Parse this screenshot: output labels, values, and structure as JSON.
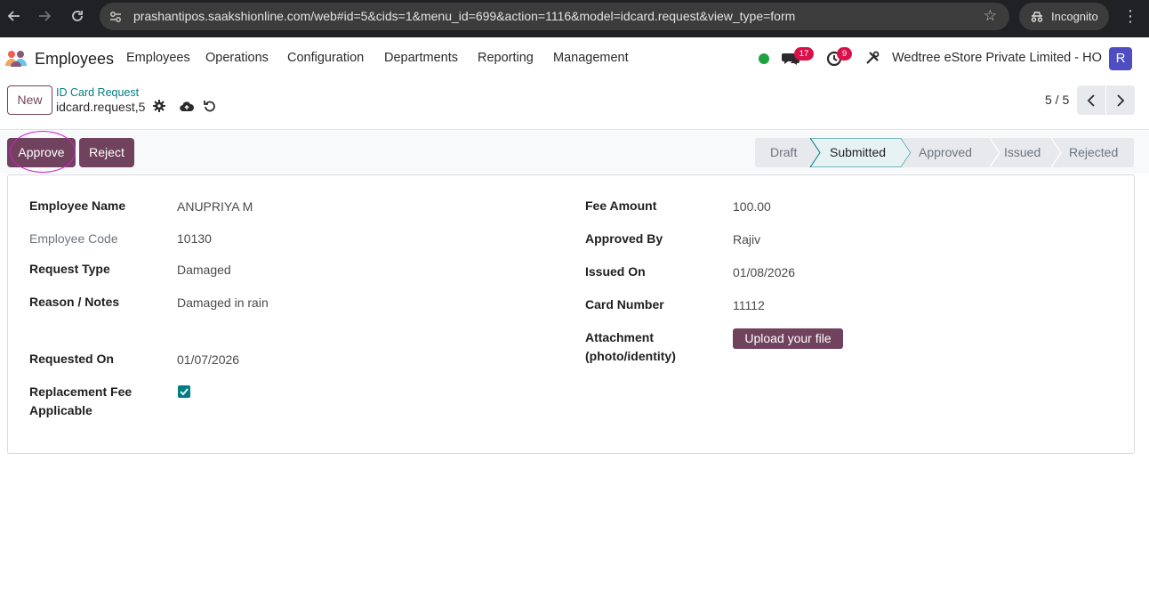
{
  "browser": {
    "url": "prashantipos.saakshionline.com/web#id=5&cids=1&menu_id=699&action=1116&model=idcard.request&view_type=form",
    "incognito_label": "Incognito"
  },
  "navbar": {
    "app_name": "Employees",
    "menu": [
      "Employees",
      "Operations",
      "Configuration",
      "Departments",
      "Reporting",
      "Management"
    ],
    "messages_count": "17",
    "activities_count": "9",
    "company": "Wedtree eStore Private Limited - HO",
    "avatar_initial": "R"
  },
  "control": {
    "new_label": "New",
    "breadcrumb": "ID Card Request",
    "record_name": "idcard.request,5",
    "pager": "5 / 5"
  },
  "statusbar": {
    "approve_label": "Approve",
    "reject_label": "Reject",
    "stages": [
      "Draft",
      "Submitted",
      "Approved",
      "Issued",
      "Rejected"
    ],
    "active_stage": "Submitted"
  },
  "form": {
    "left": {
      "employee_name_label": "Employee Name",
      "employee_name": "ANUPRIYA M",
      "employee_code_label": "Employee Code",
      "employee_code": "10130",
      "request_type_label": "Request Type",
      "request_type": "Damaged",
      "reason_label": "Reason / Notes",
      "reason": "Damaged in rain",
      "requested_on_label": "Requested On",
      "requested_on": "01/07/2026",
      "fee_applicable_label_1": "Replacement Fee",
      "fee_applicable_label_2": "Applicable",
      "fee_applicable": true
    },
    "right": {
      "fee_amount_label": "Fee Amount",
      "fee_amount": "100.00",
      "approved_by_label": "Approved By",
      "approved_by": "Rajiv",
      "issued_on_label": "Issued On",
      "issued_on": "01/08/2026",
      "card_number_label": "Card Number",
      "card_number": "11112",
      "attachment_label_1": "Attachment",
      "attachment_label_2": "(photo/identity)",
      "upload_label": "Upload your file"
    }
  },
  "colors": {
    "primary": "#71425e",
    "teal": "#017e84",
    "badge": "#d9114b",
    "online": "#1ea23f"
  }
}
